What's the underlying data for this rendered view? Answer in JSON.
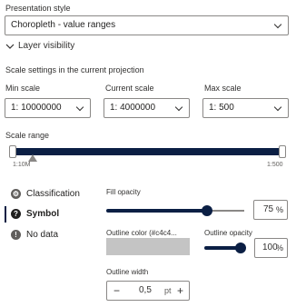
{
  "presentation": {
    "label": "Presentation style",
    "selected": "Choropleth - value ranges"
  },
  "layer_visibility": {
    "label": "Layer visibility"
  },
  "scale_settings": {
    "title": "Scale settings in the current projection",
    "min": {
      "label": "Min scale",
      "value": "1: 10000000"
    },
    "current": {
      "label": "Current scale",
      "value": "1: 4000000"
    },
    "max": {
      "label": "Max scale",
      "value": "1: 500"
    }
  },
  "scale_range": {
    "label": "Scale range",
    "tick_left": "1:10M",
    "tick_right": "1:500"
  },
  "sidebar": {
    "items": [
      {
        "label": "Classification",
        "icon": "gear-icon"
      },
      {
        "label": "Symbol",
        "icon": "question-icon"
      },
      {
        "label": "No data",
        "icon": "info-icon"
      }
    ]
  },
  "fill_opacity": {
    "label": "Fill opacity",
    "value": "75",
    "unit": "%",
    "level": 0.75
  },
  "outline_color": {
    "label": "Outline color (#c4c4...",
    "swatch": "#c4c4c4"
  },
  "outline_opacity": {
    "label": "Outline opacity",
    "value": "100",
    "unit": "%",
    "level": 1.0
  },
  "outline_width": {
    "label": "Outline width",
    "value": "0,5",
    "unit": "pt",
    "minus": "−",
    "plus": "+"
  },
  "colors": {
    "accent": "#0b1f44",
    "border": "#8a8886"
  }
}
